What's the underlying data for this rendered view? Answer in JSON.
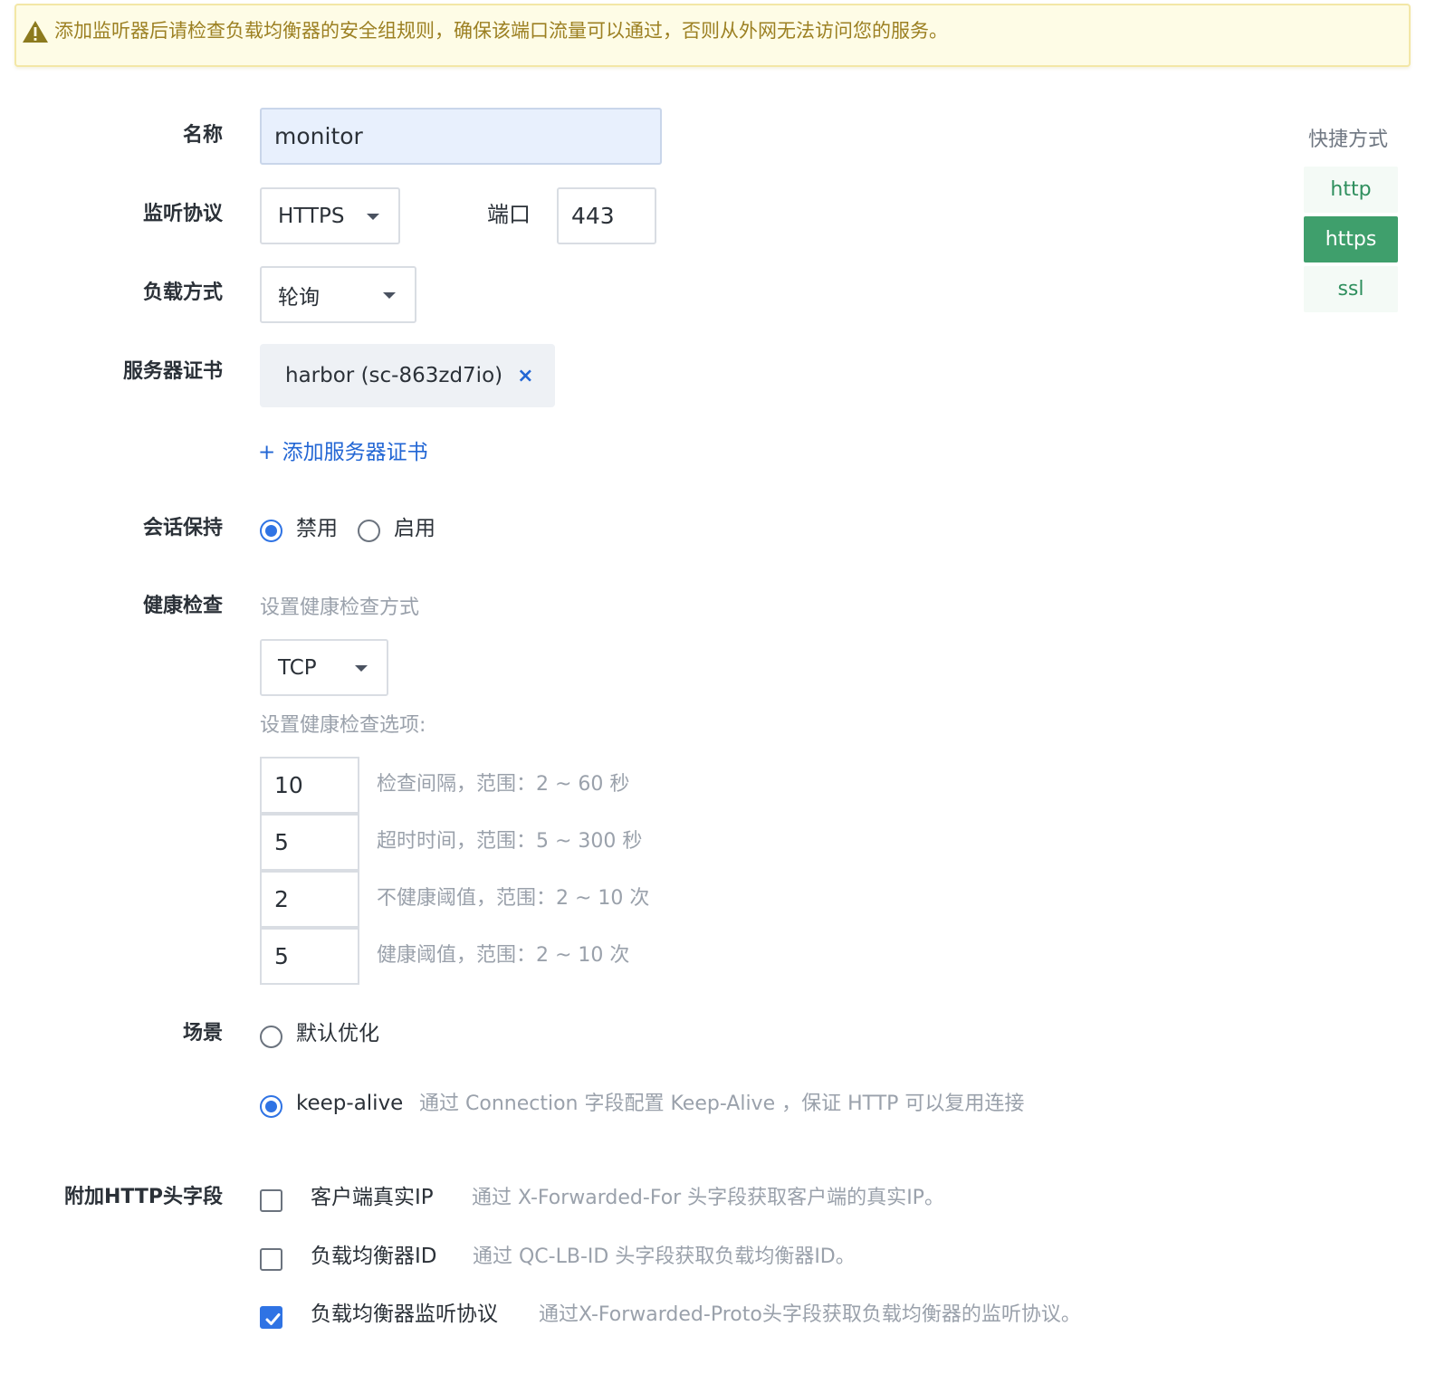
{
  "banner": {
    "icon": "warning-icon",
    "text": "添加监听器后请检查负载均衡器的安全组规则，确保该端口流量可以通过，否则从外网无法访问您的服务。"
  },
  "form": {
    "name": {
      "label": "名称",
      "value": "monitor"
    },
    "protocol": {
      "label": "监听协议",
      "value": "HTTPS"
    },
    "port": {
      "label": "端口",
      "value": "443"
    },
    "balance": {
      "label": "负载方式",
      "value": "轮询"
    },
    "cert": {
      "label": "服务器证书",
      "tag": "harbor (sc-863zd7io)",
      "remove": "×",
      "add_link": "+ 添加服务器证书"
    },
    "session": {
      "label": "会话保持",
      "options": [
        "禁用",
        "启用"
      ],
      "selected": "禁用"
    },
    "health": {
      "label": "健康检查",
      "method_hint": "设置健康检查方式",
      "method": "TCP",
      "options_hint": "设置健康检查选项:",
      "rows": [
        {
          "value": "10",
          "desc": "检查间隔，范围：2 ~ 60 秒"
        },
        {
          "value": "5",
          "desc": "超时时间，范围：5 ~ 300 秒"
        },
        {
          "value": "2",
          "desc": "不健康阈值，范围：2 ~ 10 次"
        },
        {
          "value": "5",
          "desc": "健康阈值，范围：2 ~ 10 次"
        }
      ]
    },
    "scene": {
      "label": "场景",
      "options": [
        {
          "name": "默认优化",
          "desc": "",
          "selected": false
        },
        {
          "name": "keep-alive",
          "desc": "通过 Connection 字段配置 Keep-Alive ，保证 HTTP 可以复用连接",
          "selected": true
        }
      ]
    },
    "headers": {
      "label": "附加HTTP头字段",
      "items": [
        {
          "name": "客户端真实IP",
          "desc": "通过 X-Forwarded-For 头字段获取客户端的真实IP。",
          "checked": false
        },
        {
          "name": "负载均衡器ID",
          "desc": "通过 QC-LB-ID 头字段获取负载均衡器ID。",
          "checked": false
        },
        {
          "name": "负载均衡器监听协议",
          "desc": "通过X-Forwarded-Proto头字段获取负载均衡器的监听协议。",
          "checked": true
        }
      ]
    }
  },
  "shortcuts": {
    "title": "快捷方式",
    "items": [
      "http",
      "https",
      "ssl"
    ],
    "active": "https"
  },
  "colors": {
    "accent": "#2f73e4",
    "shortcut_active": "#3f9f6c",
    "warning_text": "#9c8022",
    "warning_bg": "#fefce6"
  }
}
